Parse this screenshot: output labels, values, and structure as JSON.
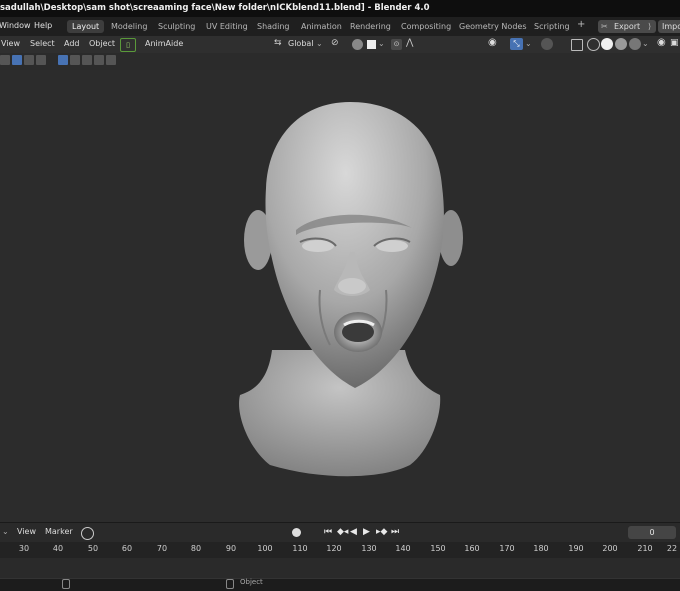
{
  "window": {
    "title": "sadullah\\Desktop\\sam shot\\screaaming face\\New folder\\nICKblend11.blend] - Blender 4.0"
  },
  "menu": {
    "window": "Window",
    "help": "Help"
  },
  "workspaces": [
    "Layout",
    "Modeling",
    "Sculpting",
    "UV Editing",
    "Shading",
    "Animation",
    "Rendering",
    "Compositing",
    "Geometry Nodes",
    "Scripting"
  ],
  "workspace_add": "+",
  "export_label": "Export",
  "import_label": "Impo",
  "viewport_menu": {
    "view": "View",
    "select": "Select",
    "add": "Add",
    "object": "Object",
    "addon": "AnimAide"
  },
  "transform_orientation": "Global",
  "timeline": {
    "view": "View",
    "marker": "Marker",
    "current_frame": "0",
    "ticks": [
      "30",
      "40",
      "50",
      "60",
      "70",
      "80",
      "90",
      "100",
      "110",
      "120",
      "130",
      "140",
      "150",
      "160",
      "170",
      "180",
      "190",
      "200",
      "210",
      "22"
    ]
  },
  "status": {
    "object": "Object"
  },
  "icons": {
    "cursor": "cursor-icon",
    "gizmo": "gizmo-icon",
    "overlay": "overlay-icon",
    "xray": "xray-icon",
    "wire": "wireframe-shading-icon",
    "solid": "solid-shading-icon",
    "material": "material-shading-icon",
    "render": "rendered-shading-icon",
    "eye": "eye-icon",
    "sync": "sync-icon",
    "jump-start": "jump-start-icon",
    "prev-key": "prev-keyframe-icon",
    "play-rev": "play-reverse-icon",
    "play": "play-icon",
    "next-key": "next-keyframe-icon",
    "jump-end": "jump-end-icon",
    "record": "record-icon"
  },
  "colors": {
    "accent": "#4772b3",
    "active_tab": "#3d3d3d",
    "header": "#1f1f1f"
  }
}
